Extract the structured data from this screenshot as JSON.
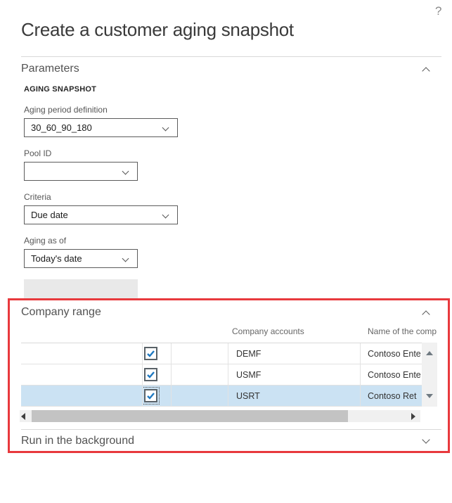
{
  "window": {
    "help_icon": "?",
    "title": "Create a customer aging snapshot"
  },
  "parameters_section": {
    "title": "Parameters",
    "group_header": "AGING SNAPSHOT",
    "fields": [
      {
        "label": "Aging period definition",
        "value": "30_60_90_180"
      },
      {
        "label": "Pool ID",
        "value": ""
      },
      {
        "label": "Criteria",
        "value": "Due date"
      },
      {
        "label": "Aging as of",
        "value": "Today's date"
      }
    ],
    "disabled_field_value": ""
  },
  "company_range_section": {
    "title": "Company range",
    "columns": {
      "company_accounts": "Company accounts",
      "company_name": "Name of the comp"
    },
    "rows": [
      {
        "checked": true,
        "account": "DEMF",
        "name": "Contoso Ente",
        "selected": false
      },
      {
        "checked": true,
        "account": "USMF",
        "name": "Contoso Ente",
        "selected": false
      },
      {
        "checked": true,
        "account": "USRT",
        "name": "Contoso Ret",
        "selected": true
      }
    ]
  },
  "run_in_background_section": {
    "title": "Run in the background"
  },
  "colors": {
    "annotation_red": "#e8393d",
    "selection_blue": "#cbe2f3",
    "checkbox_check_blue": "#1d78c1"
  }
}
